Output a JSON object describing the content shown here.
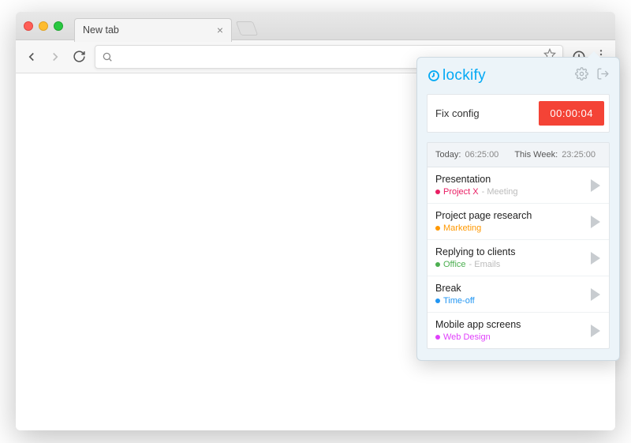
{
  "tab": {
    "title": "New tab"
  },
  "popup": {
    "brand": "lockify",
    "running": {
      "label": "Fix config",
      "timer": "00:00:04"
    },
    "summary": {
      "today_label": "Today:",
      "today_value": "06:25:00",
      "week_label": "This Week:",
      "week_value": "23:25:00"
    },
    "entries": [
      {
        "title": "Presentation",
        "project": "Project X",
        "project_color": "#e91e63",
        "tag": "Meeting"
      },
      {
        "title": "Project page research",
        "project": "Marketing",
        "project_color": "#ff9800",
        "tag": ""
      },
      {
        "title": "Replying to clients",
        "project": "Office",
        "project_color": "#4caf50",
        "tag": "Emails"
      },
      {
        "title": "Break",
        "project": "Time-off",
        "project_color": "#2196f3",
        "tag": ""
      },
      {
        "title": "Mobile app screens",
        "project": "Web Design",
        "project_color": "#e040fb",
        "tag": ""
      }
    ]
  }
}
